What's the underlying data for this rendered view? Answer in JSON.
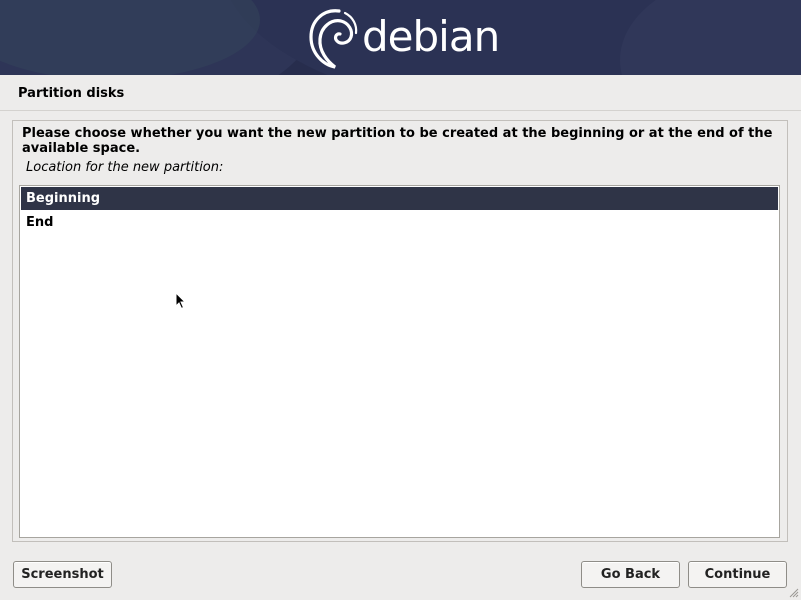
{
  "banner": {
    "logo_text": "debian",
    "logo_icon": "debian-swirl-icon",
    "background_color": "#272d4d"
  },
  "page": {
    "title": "Partition disks"
  },
  "dialog": {
    "question": "Please choose whether you want the new partition to be created at the beginning or at the end of the available space.",
    "prompt": "Location for the new partition:",
    "options": [
      {
        "label": "Beginning",
        "selected": true
      },
      {
        "label": "End",
        "selected": false
      }
    ],
    "selected_color": "#2f3447"
  },
  "buttons": {
    "screenshot": "Screenshot",
    "go_back": "Go Back",
    "continue": "Continue"
  },
  "icons": {
    "cursor": "mouse-pointer-icon",
    "resize": "resize-grip-icon"
  }
}
